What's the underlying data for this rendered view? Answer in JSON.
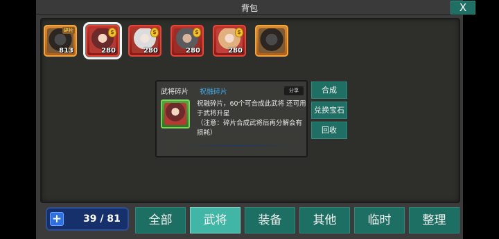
{
  "window": {
    "title": "背包",
    "close_label": "X"
  },
  "inventory": [
    {
      "count": "813",
      "badge": "碎片",
      "frame": "orange",
      "portrait": "beast"
    },
    {
      "count": "280",
      "coin": "$",
      "frame": "red",
      "portrait": "girl",
      "selected": true
    },
    {
      "count": "280",
      "coin": "$",
      "frame": "red",
      "portrait": "elder"
    },
    {
      "count": "280",
      "coin": "$",
      "frame": "red",
      "portrait": "warrior"
    },
    {
      "count": "280",
      "coin": "$",
      "frame": "red",
      "portrait": "lady"
    },
    {
      "count": "",
      "frame": "orange",
      "portrait": "beast"
    }
  ],
  "info": {
    "category": "武将碎片",
    "name": "祝融碎片",
    "share_label": "分享",
    "description": "祝融碎片，60个可合成此武将 还可用于武将升星",
    "note": "（注意：碎片合成武将后再分解会有损耗）"
  },
  "actions": {
    "compose": "合成",
    "exchange": "兑换宝石",
    "recycle": "回收"
  },
  "capacity": {
    "text": "39 / 81",
    "used": 39,
    "total": 81
  },
  "tabs": [
    {
      "label": "全部",
      "active": false
    },
    {
      "label": "武将",
      "active": true
    },
    {
      "label": "装备",
      "active": false
    },
    {
      "label": "其他",
      "active": false
    },
    {
      "label": "临时",
      "active": false
    },
    {
      "label": "整理",
      "active": false
    }
  ],
  "colors": {
    "accent": "#1e6f63",
    "accent_active": "#42b6a6",
    "link": "#3fa9e6"
  }
}
